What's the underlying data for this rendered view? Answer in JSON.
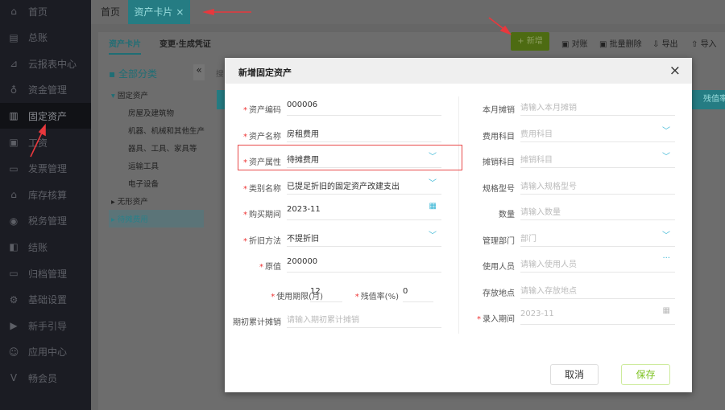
{
  "sidebar": {
    "items": [
      {
        "label": "首页",
        "icon": "home-icon"
      },
      {
        "label": "总账",
        "icon": "ledger-icon"
      },
      {
        "label": "云报表中心",
        "icon": "chart-icon"
      },
      {
        "label": "资金管理",
        "icon": "money-bag-icon"
      },
      {
        "label": "固定资产",
        "icon": "building-icon",
        "active": true
      },
      {
        "label": "工资",
        "icon": "salary-icon"
      },
      {
        "label": "发票管理",
        "icon": "invoice-icon"
      },
      {
        "label": "库存核算",
        "icon": "warehouse-icon"
      },
      {
        "label": "税务管理",
        "icon": "tax-icon"
      },
      {
        "label": "结账",
        "icon": "checkout-icon"
      },
      {
        "label": "归档管理",
        "icon": "archive-icon"
      },
      {
        "label": "基础设置",
        "icon": "gear-icon"
      },
      {
        "label": "新手引导",
        "icon": "video-icon"
      },
      {
        "label": "应用中心",
        "icon": "app-icon"
      },
      {
        "label": "畅会员",
        "icon": "vip-icon"
      }
    ]
  },
  "tabs": {
    "home": "首页",
    "active": "资产卡片",
    "close": "×"
  },
  "subtabs": {
    "card": "资产卡片",
    "change": "变更·生成凭证"
  },
  "toolbar": {
    "add": "+ 新增",
    "reconcile": "对账",
    "batch_delete": "批量删除",
    "export": "导出",
    "import": "导入"
  },
  "tree": {
    "root": "全部分类",
    "collapse": "«",
    "search_hint": "搜",
    "nodes": [
      {
        "label": "固定资产",
        "expanded": true,
        "children": [
          "房屋及建筑物",
          "机器、机械和其他生产设",
          "器具、工具、家具等",
          "运输工具",
          "电子设备"
        ]
      },
      {
        "label": "无形资产"
      },
      {
        "label": "待摊费用",
        "selected": true
      }
    ]
  },
  "table_hint": "残值率",
  "modal": {
    "title": "新增固定资产",
    "close": "×",
    "left": [
      {
        "label": "资产编码",
        "required": true,
        "value": "000006"
      },
      {
        "label": "资产名称",
        "required": true,
        "value": "房租费用"
      },
      {
        "label": "资产属性",
        "required": true,
        "value": "待摊费用",
        "dropdown": true
      },
      {
        "label": "类别名称",
        "required": true,
        "value": "已提足折旧的固定资产改建支出",
        "dropdown": true
      },
      {
        "label": "购买期间",
        "required": true,
        "value": "2023-11",
        "calendar": true
      },
      {
        "label": "折旧方法",
        "required": true,
        "value": "不提折旧",
        "dropdown": true
      },
      {
        "label": "原值",
        "required": true,
        "value": "200000"
      }
    ],
    "life": {
      "label": "使用期限(月)",
      "value": "12"
    },
    "residual": {
      "label": "残值率(%)",
      "value": "0"
    },
    "opening": {
      "label": "期初累计摊销",
      "placeholder": "请输入期初累计摊销"
    },
    "right": [
      {
        "label": "本月摊销",
        "placeholder": "请输入本月摊销"
      },
      {
        "label": "费用科目",
        "placeholder": "费用科目",
        "dropdown": true
      },
      {
        "label": "摊销科目",
        "placeholder": "摊销科目",
        "dropdown": true
      },
      {
        "label": "规格型号",
        "placeholder": "请输入规格型号"
      },
      {
        "label": "数量",
        "placeholder": "请输入数量"
      },
      {
        "label": "管理部门",
        "placeholder": "部门",
        "dropdown": true
      },
      {
        "label": "使用人员",
        "placeholder": "请输入使用人员",
        "more": true
      },
      {
        "label": "存放地点",
        "placeholder": "请输入存放地点"
      },
      {
        "label": "录入期间",
        "placeholder": "2023-11",
        "required": true,
        "calendar": true
      }
    ],
    "cancel": "取消",
    "save": "保存"
  },
  "colors": {
    "accent": "#3bb7d6",
    "save": "#7cc21e",
    "highlight": "#e84a4a"
  }
}
